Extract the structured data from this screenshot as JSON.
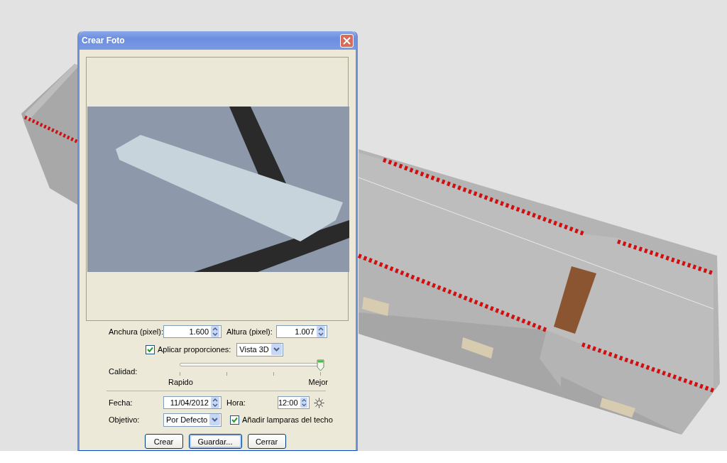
{
  "window": {
    "title": "Crear Foto"
  },
  "width": {
    "label": "Anchura (pixel):",
    "value": "1.600"
  },
  "height": {
    "label": "Altura (pixel):",
    "value": "1.007"
  },
  "proportions": {
    "label": "Aplicar proporciones:",
    "checked": true,
    "value": "Vista 3D"
  },
  "quality": {
    "label": "Calidad:",
    "level": 1,
    "min_label": "Rapido",
    "max_label": "Mejor"
  },
  "date": {
    "label": "Fecha:",
    "value": "11/04/2012"
  },
  "time": {
    "label": "Hora:",
    "value": "12:00"
  },
  "lens": {
    "label": "Objetivo:",
    "value": "Por Defecto"
  },
  "ceiling_lights": {
    "label": "Añadir lamparas del techo",
    "checked": true
  },
  "buttons": [
    "Crear",
    "Guardar...",
    "Cerrar"
  ]
}
